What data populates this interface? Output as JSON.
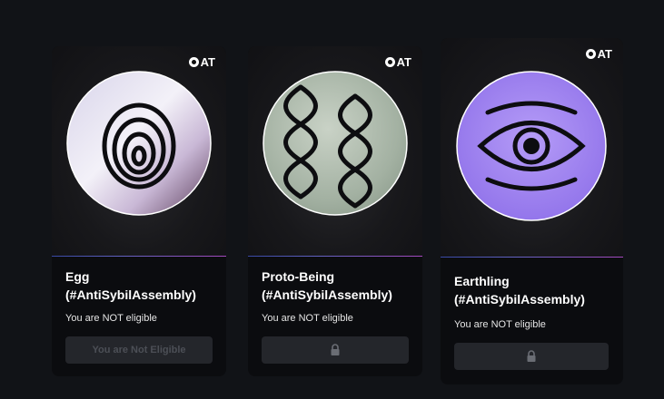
{
  "brand": {
    "logo_text": "AT"
  },
  "cards": [
    {
      "title_line1": "Egg",
      "title_line2": "(#AntiSybilAssembly)",
      "status": "You are NOT eligible",
      "button_label": "You are Not Eligible",
      "icon": "concentric-egg-icon"
    },
    {
      "title_line1": "Proto-Being",
      "title_line2": "(#AntiSybilAssembly)",
      "status": "You are NOT eligible",
      "button_label": "",
      "icon": "dna-helix-icon"
    },
    {
      "title_line1": "Earthling",
      "title_line2": "(#AntiSybilAssembly)",
      "status": "You are NOT eligible",
      "button_label": "",
      "icon": "eye-icon"
    }
  ],
  "colors": {
    "background": "#111317",
    "card": "#0b0c0f",
    "button_disabled": "#24262b",
    "earthling_disc": "#9b7cf2",
    "proto_disc": "#a9b7a8"
  }
}
